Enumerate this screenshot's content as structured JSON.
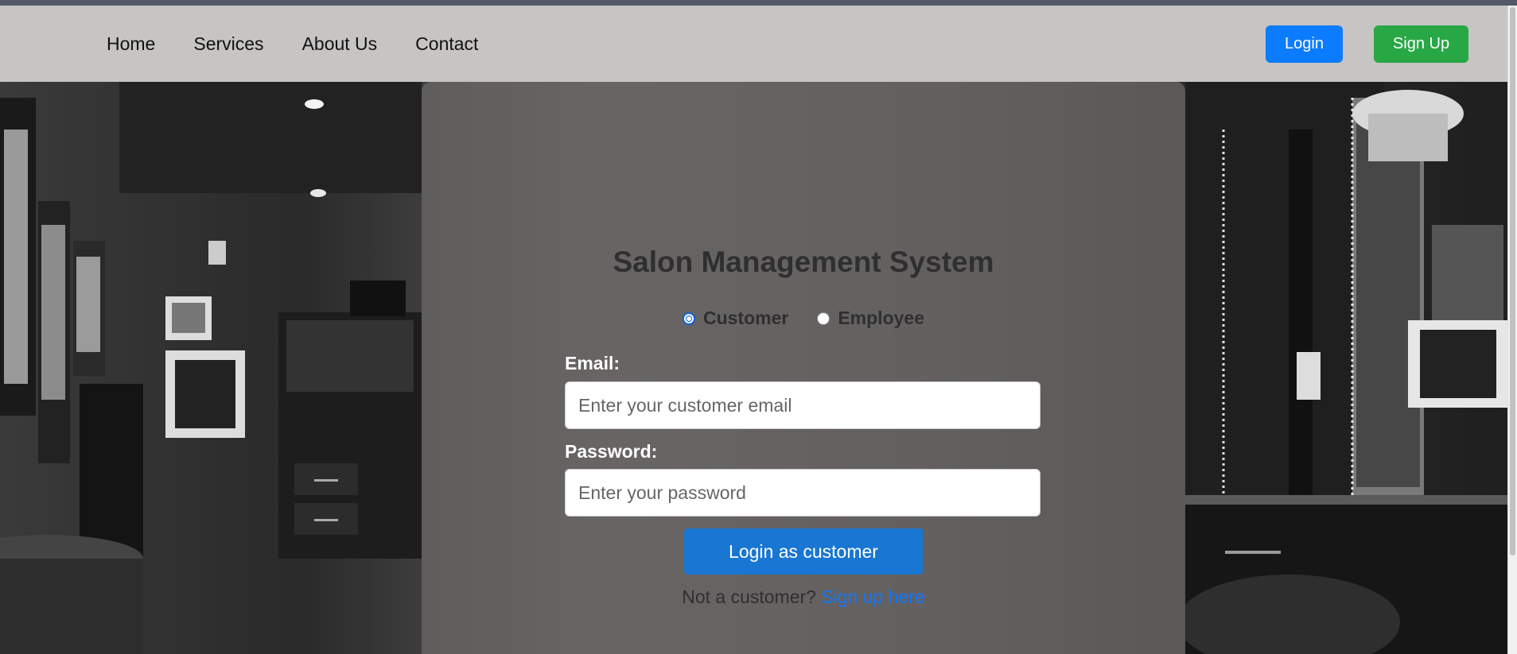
{
  "nav": {
    "links": [
      "Home",
      "Services",
      "About Us",
      "Contact"
    ],
    "login_label": "Login",
    "signup_label": "Sign Up"
  },
  "card": {
    "title": "Salon Management System",
    "roles": [
      {
        "label": "Customer",
        "selected": true
      },
      {
        "label": "Employee",
        "selected": false
      }
    ],
    "email_label": "Email:",
    "email_placeholder": "Enter your customer email",
    "password_label": "Password:",
    "password_placeholder": "Enter your password",
    "submit_label": "Login as customer",
    "signup_prompt": "Not a customer?",
    "signup_link": "Sign up here"
  },
  "colors": {
    "navbar_bg": "#c6c5c3",
    "login_btn": "#0b7bff",
    "signup_btn": "#28a745",
    "submit_btn": "#1976d2",
    "link": "#1177ff"
  },
  "icons": [
    "radio-checked-icon",
    "radio-unchecked-icon"
  ]
}
